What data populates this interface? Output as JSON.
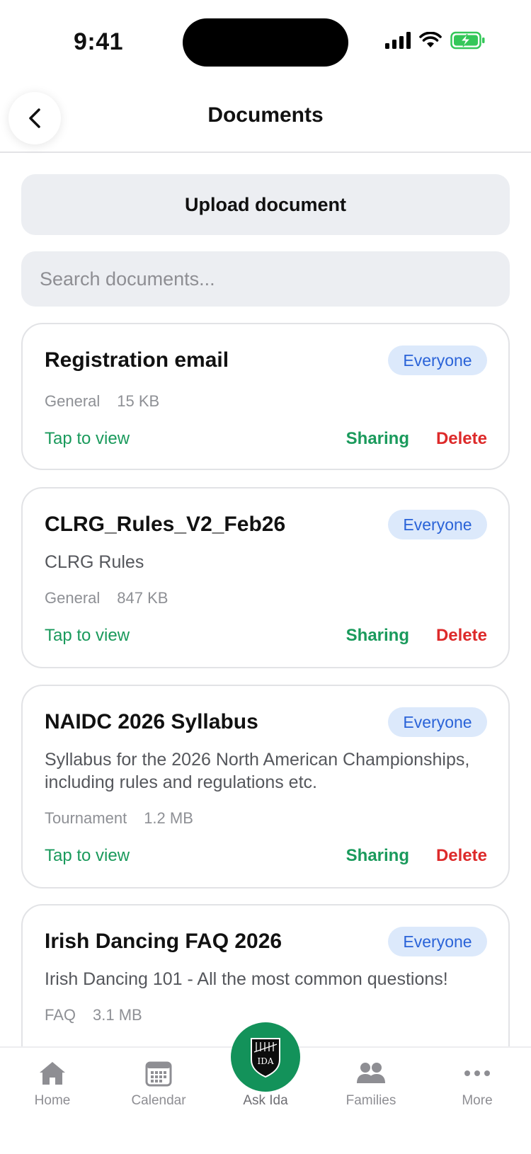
{
  "status_bar": {
    "time": "9:41"
  },
  "header": {
    "title": "Documents"
  },
  "upload": {
    "label": "Upload document"
  },
  "search": {
    "placeholder": "Search documents..."
  },
  "documents": [
    {
      "title": "Registration email",
      "badge": "Everyone",
      "category": "General",
      "size": "15 KB",
      "tap_label": "Tap to view",
      "sharing_label": "Sharing",
      "delete_label": "Delete"
    },
    {
      "title": "CLRG_Rules_V2_Feb26",
      "badge": "Everyone",
      "description": "CLRG Rules",
      "category": "General",
      "size": "847 KB",
      "tap_label": "Tap to view",
      "sharing_label": "Sharing",
      "delete_label": "Delete"
    },
    {
      "title": "NAIDC 2026 Syllabus",
      "badge": "Everyone",
      "description": "Syllabus for the 2026 North American Championships, including rules and regulations etc.",
      "category": "Tournament",
      "size": "1.2 MB",
      "tap_label": "Tap to view",
      "sharing_label": "Sharing",
      "delete_label": "Delete"
    },
    {
      "title": "Irish Dancing FAQ 2026",
      "badge": "Everyone",
      "description": "Irish Dancing 101 - All the most common questions!",
      "category": "FAQ",
      "size": "3.1 MB"
    }
  ],
  "tabs": [
    {
      "label": "Home",
      "icon": "home-icon"
    },
    {
      "label": "Calendar",
      "icon": "calendar-icon"
    },
    {
      "label": "Ask Ida",
      "icon": "ida-logo-icon"
    },
    {
      "label": "Families",
      "icon": "families-icon"
    },
    {
      "label": "More",
      "icon": "more-icon"
    }
  ],
  "logo_text": "IDA",
  "colors": {
    "accent_green": "#13925a",
    "link_green": "#1a9a5c",
    "delete_red": "#dd2a2a",
    "badge_bg": "#dce9fb",
    "badge_text": "#2a63d8"
  }
}
